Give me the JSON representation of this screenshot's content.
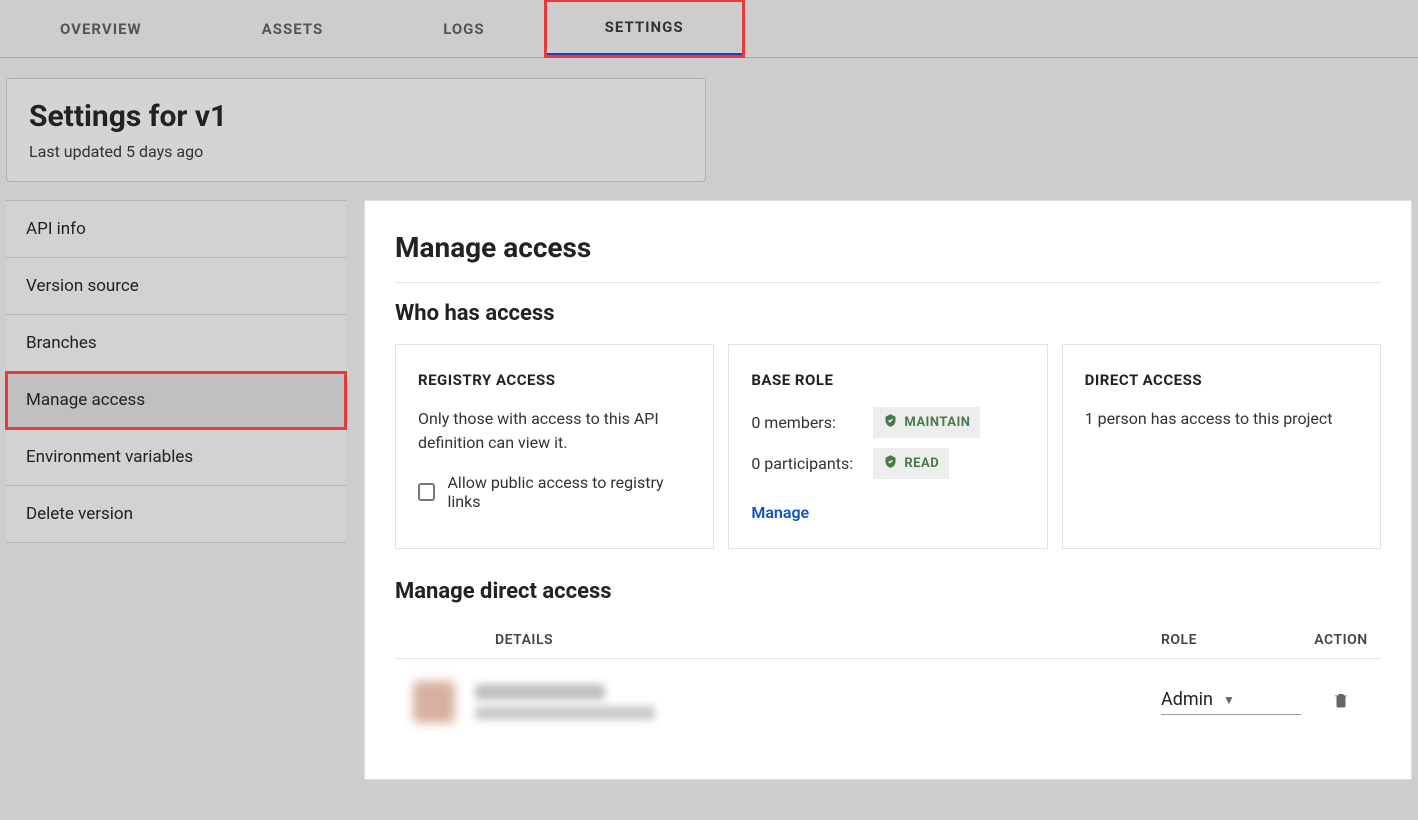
{
  "tabs": [
    {
      "label": "OVERVIEW",
      "active": false
    },
    {
      "label": "ASSETS",
      "active": false
    },
    {
      "label": "LOGS",
      "active": false
    },
    {
      "label": "SETTINGS",
      "active": true,
      "highlighted": true
    }
  ],
  "header": {
    "title": "Settings for v1",
    "sub": "Last updated 5 days ago"
  },
  "sidebar": {
    "items": [
      {
        "label": "API info",
        "selected": false
      },
      {
        "label": "Version source",
        "selected": false
      },
      {
        "label": "Branches",
        "selected": false
      },
      {
        "label": "Manage access",
        "selected": true,
        "highlighted": true
      },
      {
        "label": "Environment variables",
        "selected": false
      },
      {
        "label": "Delete version",
        "selected": false
      }
    ]
  },
  "panel": {
    "title": "Manage access",
    "who_has_access": "Who has access",
    "cards": {
      "registry": {
        "title": "REGISTRY ACCESS",
        "desc": "Only those with access to this API definition can view it.",
        "checkbox_label": "Allow public access to registry links"
      },
      "base_role": {
        "title": "BASE ROLE",
        "members_label": "0 members:",
        "members_badge": "MAINTAIN",
        "participants_label": "0 participants:",
        "participants_badge": "READ",
        "manage_link": "Manage"
      },
      "direct": {
        "title": "DIRECT ACCESS",
        "desc": "1 person has access to this project"
      }
    },
    "manage_direct": "Manage direct access",
    "columns": {
      "details": "DETAILS",
      "role": "ROLE",
      "action": "ACTION"
    },
    "rows": [
      {
        "role": "Admin"
      }
    ]
  }
}
